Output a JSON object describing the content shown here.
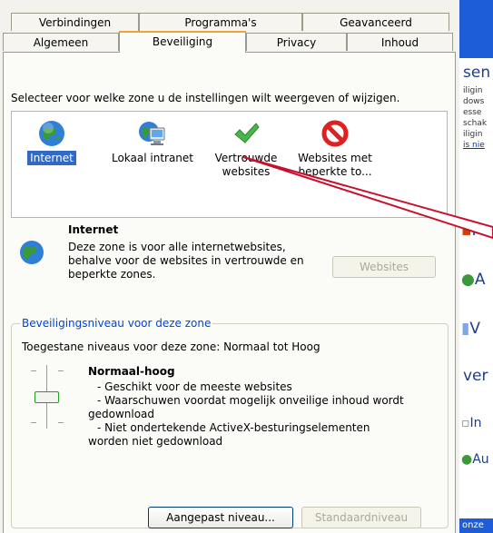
{
  "tabs_row1": [
    "Verbindingen",
    "Programma's",
    "Geavanceerd"
  ],
  "tabs_row2": [
    "Algemeen",
    "Beveiliging",
    "Privacy",
    "Inhoud"
  ],
  "instruction": "Selecteer voor welke zone u de instellingen wilt weergeven of wijzigen.",
  "zones": [
    {
      "label_line1": "Internet",
      "label_line2": "",
      "icon": "globe-icon",
      "selected": true
    },
    {
      "label_line1": "Lokaal intranet",
      "label_line2": "",
      "icon": "intranet-computer-icon",
      "selected": false
    },
    {
      "label_line1": "Vertrouwde",
      "label_line2": "websites",
      "icon": "checkmark-icon",
      "selected": false
    },
    {
      "label_line1": "Websites met",
      "label_line2": "beperkte to...",
      "icon": "restricted-icon",
      "selected": false
    }
  ],
  "zone_info": {
    "title": "Internet",
    "description_line1": "Deze zone is voor alle internetwebsites,",
    "description_line2": "behalve voor de websites in vertrouwde en",
    "description_line3": "beperkte zones.",
    "websites_button": "Websites"
  },
  "security_group": {
    "legend": "Beveiligingsniveau voor deze zone",
    "allowed_levels": "Toegestane niveaus voor deze zone: Normaal tot Hoog",
    "level_name": "Normaal-hoog",
    "bullet1": "- Geschikt voor de meeste websites",
    "bullet2_line1": "- Waarschuwen voordat mogelijk onveilige inhoud wordt",
    "bullet2_line2": "gedownload",
    "bullet3_line1": "- Niet ondertekende ActiveX-besturingselementen",
    "bullet3_line2": "worden niet gedownload",
    "custom_button": "Aangepast niveau...",
    "default_button": "Standaardniveau"
  },
  "background_page": {
    "heading_fragment": "sen",
    "lines": [
      "iligin",
      "dows",
      "esse",
      "schak",
      "iligin",
      "is nie"
    ],
    "items": [
      "F",
      "A",
      "V",
      "ver",
      "In",
      "Au"
    ],
    "footer_fragment": "onze"
  },
  "colors": {
    "accent": "#f0a33c",
    "link": "#0046d5",
    "annotation_arrow": "#c8102e",
    "selected_bg": "#316ac5",
    "right_header": "#1d5ed8"
  }
}
